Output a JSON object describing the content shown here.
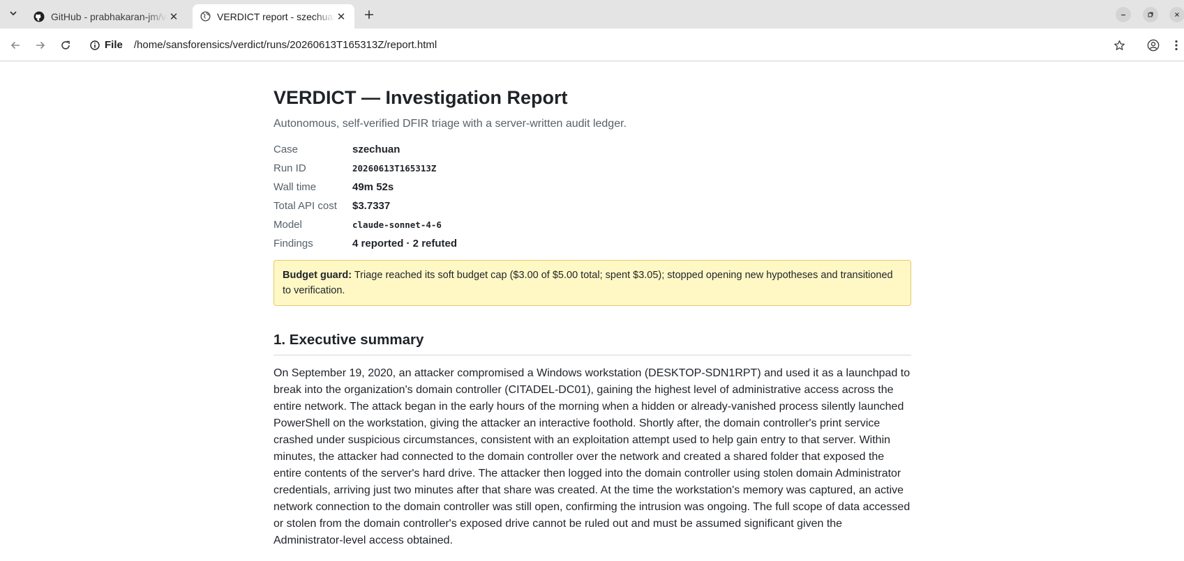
{
  "browser": {
    "tabs": [
      {
        "title": "GitHub - prabhakaran-jm/verdict",
        "active": false,
        "favicon": "github-icon"
      },
      {
        "title": "VERDICT report - szechuan",
        "active": true,
        "favicon": "globe-icon"
      }
    ],
    "address": {
      "scheme_label": "File",
      "url": "/home/sansforensics/verdict/runs/20260613T165313Z/report.html"
    }
  },
  "report": {
    "title": "VERDICT — Investigation Report",
    "subtitle": "Autonomous, self-verified DFIR triage with a server-written audit ledger.",
    "meta": [
      {
        "label": "Case",
        "value": "szechuan"
      },
      {
        "label": "Run ID",
        "value": "20260613T165313Z"
      },
      {
        "label": "Wall time",
        "value": "49m 52s"
      },
      {
        "label": "Total API cost",
        "value": "$3.7337"
      },
      {
        "label": "Model",
        "value": "claude-sonnet-4-6"
      },
      {
        "label": "Findings",
        "value": "4 reported · 2 refuted"
      }
    ],
    "budget": {
      "label": "Budget guard:",
      "text": "Triage reached its soft budget cap ($3.00 of $5.00 total; spent $3.05); stopped opening new hypotheses and transitioned to verification."
    },
    "sections": [
      {
        "title": "1. Executive summary",
        "body": "On September 19, 2020, an attacker compromised a Windows workstation (DESKTOP-SDN1RPT) and used it as a launchpad to break into the organization's domain controller (CITADEL-DC01), gaining the highest level of administrative access across the entire network. The attack began in the early hours of the morning when a hidden or already-vanished process silently launched PowerShell on the workstation, giving the attacker an interactive foothold. Shortly after, the domain controller's print service crashed under suspicious circumstances, consistent with an exploitation attempt used to help gain entry to that server. Within minutes, the attacker had connected to the domain controller over the network and created a shared folder that exposed the entire contents of the server's hard drive. The attacker then logged into the domain controller using stolen domain Administrator credentials, arriving just two minutes after that share was created. At the time the workstation's memory was captured, an active network connection to the domain controller was still open, confirming the intrusion was ongoing. The full scope of data accessed or stolen from the domain controller's exposed drive cannot be ruled out and must be assumed significant given the Administrator-level access obtained."
      }
    ]
  }
}
